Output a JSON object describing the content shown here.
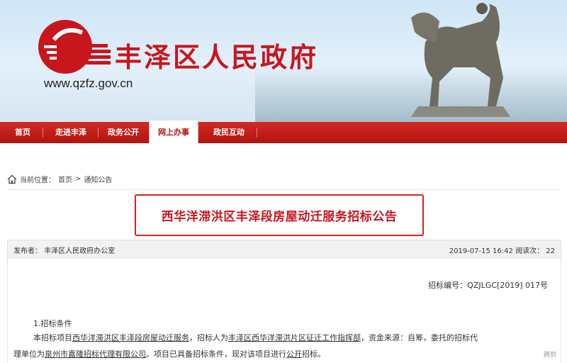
{
  "header": {
    "site_title": "丰泽区人民政府",
    "site_url": "www.qzfz.gov.cn",
    "brand_color": "#c8161d"
  },
  "nav": {
    "items": [
      {
        "label": "首页"
      },
      {
        "label": "走进丰泽"
      },
      {
        "label": "政务公开"
      },
      {
        "label": "网上办事"
      },
      {
        "label": "政民互动"
      }
    ],
    "active_index": 3,
    "bar_color": "#c01b15"
  },
  "breadcrumb": {
    "prefix": "当前位置：",
    "home": "首页",
    "sep": ">",
    "current": "通知公告"
  },
  "article": {
    "title": "西华洋滞洪区丰泽段房屋动迁服务招标公告",
    "publisher": "发布者：  丰泽区人民政府办公室",
    "datetime": "2019-07-15 16:42",
    "reads_label": "阅读次：",
    "reads": "22",
    "bid_no": "招标编号：QZJLGC[2019] 017号",
    "section_1": "1.招标条件",
    "p1_a": "本招标项目",
    "p1_project": "西华洋滞洪区丰泽段房屋动迁服务",
    "p1_b": "，招标人为",
    "p1_tenderer": "丰泽区西华洋滞洪片区征迁工作指挥部",
    "p1_c": "，资金来源：自筹，委托的招标代",
    "p2_a": "理单位为",
    "p2_agent": "泉州市嘉隆招标代理有限公司",
    "p2_b": "。项目已具备招标条件，现对该项目进行",
    "p2_method": "公开",
    "p2_c": "招标。"
  },
  "watermark": "跨到"
}
